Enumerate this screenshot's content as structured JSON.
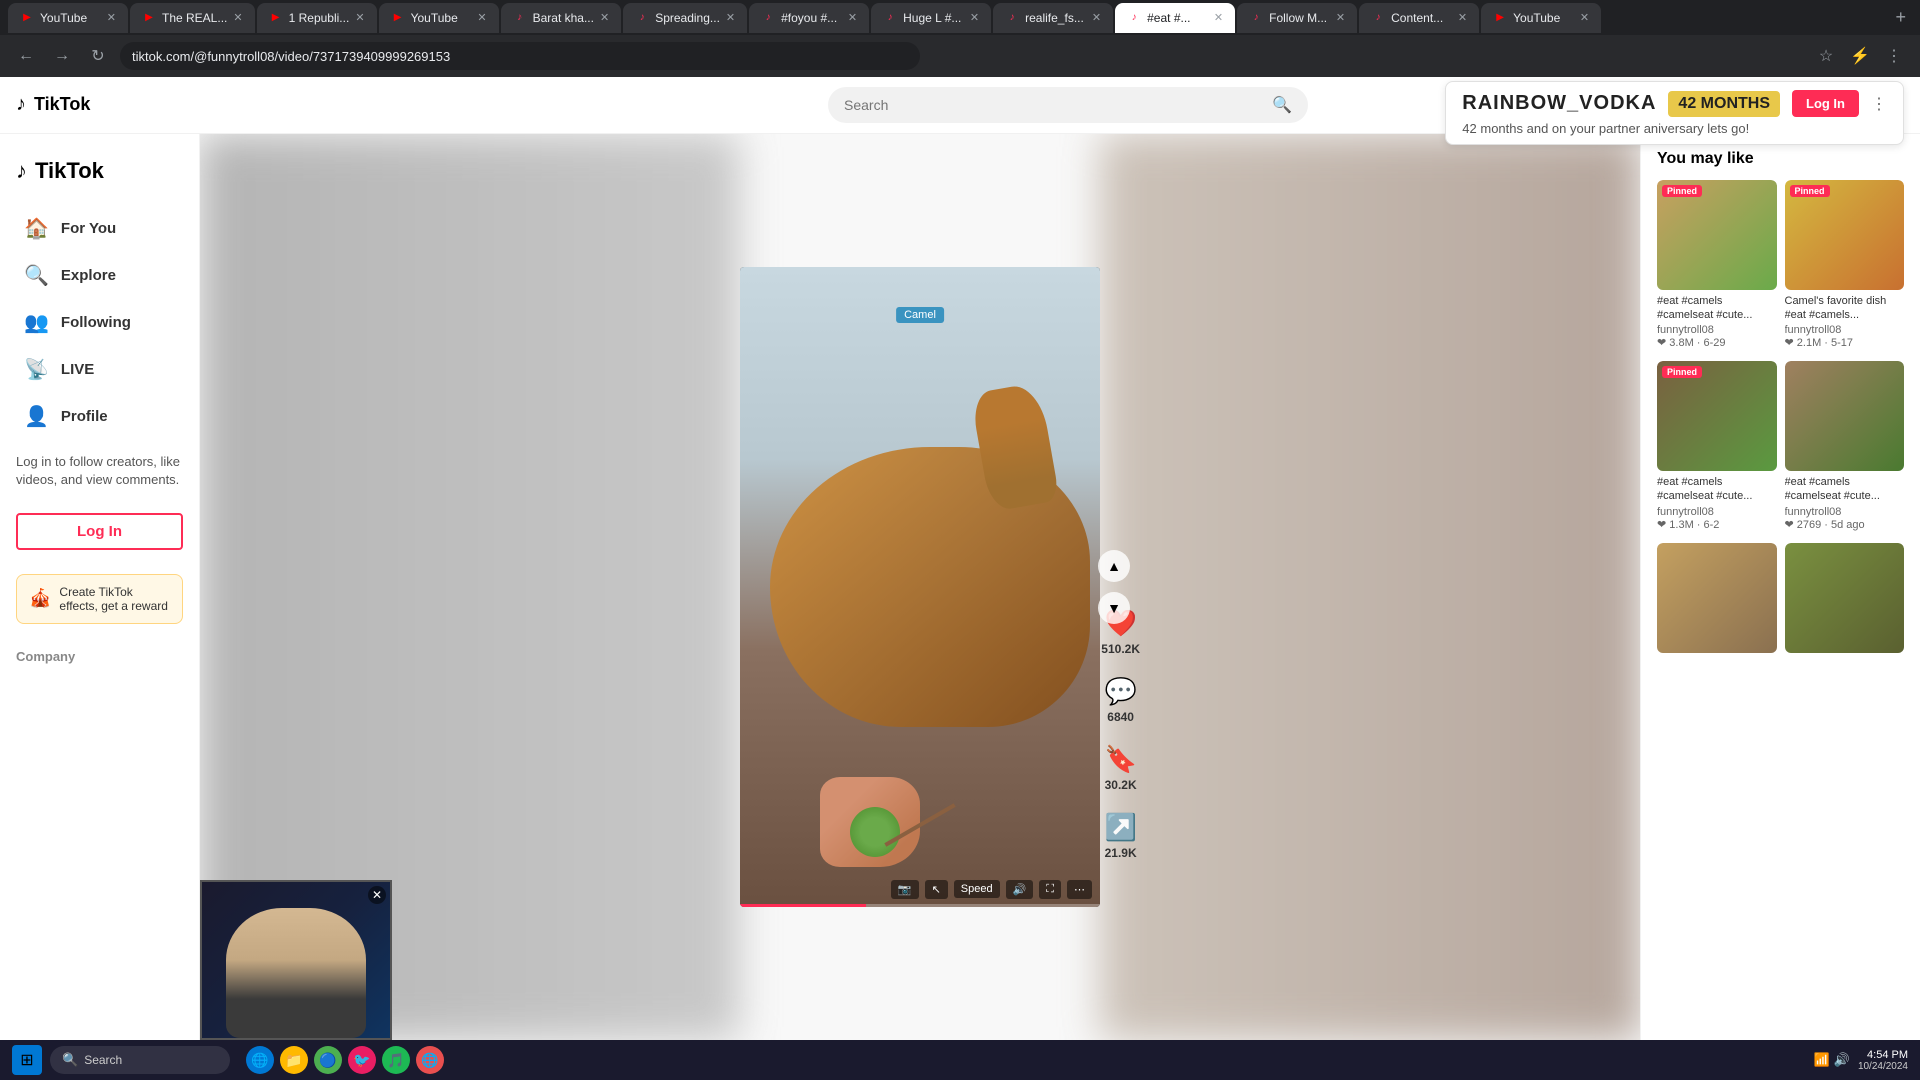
{
  "browser": {
    "tabs": [
      {
        "label": "YouTube",
        "favicon": "▶",
        "active": false,
        "color": "#ff0000"
      },
      {
        "label": "The REAL...",
        "favicon": "▶",
        "active": false,
        "color": "#ff0000"
      },
      {
        "label": "1 Republi...",
        "favicon": "▶",
        "active": false,
        "color": "#ff0000"
      },
      {
        "label": "YouTube",
        "favicon": "▶",
        "active": false,
        "color": "#ff0000"
      },
      {
        "label": "Barat kha...",
        "favicon": "♪",
        "active": false,
        "color": "#fe2c55"
      },
      {
        "label": "Spreading...",
        "favicon": "♪",
        "active": false,
        "color": "#fe2c55"
      },
      {
        "label": "#foyou #...",
        "favicon": "♪",
        "active": false,
        "color": "#fe2c55"
      },
      {
        "label": "Huge L #...",
        "favicon": "♪",
        "active": false,
        "color": "#fe2c55"
      },
      {
        "label": "realife_fs...",
        "favicon": "♪",
        "active": false,
        "color": "#fe2c55"
      },
      {
        "label": "#eat #...",
        "favicon": "♪",
        "active": true,
        "color": "#fe2c55"
      },
      {
        "label": "Follow M...",
        "favicon": "♪",
        "active": false,
        "color": "#fe2c55"
      },
      {
        "label": "Content...",
        "favicon": "♪",
        "active": false,
        "color": "#fe2c55"
      },
      {
        "label": "YouTube",
        "favicon": "▶",
        "active": false,
        "color": "#ff0000"
      }
    ],
    "address": "tiktok.com/@funnytroll08/video/7371739409999269153"
  },
  "header": {
    "logo": "TikTok",
    "search_placeholder": "Search"
  },
  "sidebar": {
    "logo_text": "TikTok",
    "nav_items": [
      {
        "label": "For You",
        "icon": "🏠"
      },
      {
        "label": "Explore",
        "icon": "🔍"
      },
      {
        "label": "Following",
        "icon": "👥"
      },
      {
        "label": "LIVE",
        "icon": "📡"
      },
      {
        "label": "Profile",
        "icon": "👤"
      }
    ],
    "login_prompt": "Log in to follow creators, like videos, and view comments.",
    "login_btn": "Log In",
    "effects_text": "Create TikTok effects, get a reward",
    "company_label": "Company"
  },
  "video": {
    "overlay_text": "Camel",
    "like_count": "510.2K",
    "comment_count": "6840",
    "save_count": "30.2K",
    "share_count": "21.9K",
    "speed_label": "Speed"
  },
  "anniversary": {
    "brand": "RAINBOW_VODKA",
    "months": "42 MONTHS",
    "subtitle": "42 months and on your partner aniversary lets go!",
    "login_btn": "Log In"
  },
  "right_panel": {
    "title": "You may like",
    "videos": [
      {
        "title": "#eat #camels #camelseat #cute...",
        "user": "funnytroll08",
        "likes": "3.8M",
        "date": "6-29",
        "pinned": true,
        "color1": "#8B6543",
        "color2": "#4a7a30"
      },
      {
        "title": "Camel's favorite dish #eat #camels...",
        "user": "funnytroll08",
        "likes": "2.1M",
        "date": "5-17",
        "pinned": true,
        "color1": "#c8a060",
        "color2": "#d4c040"
      },
      {
        "title": "#eat #camels #camelseat #cute...",
        "user": "funnytroll08",
        "likes": "1.3M",
        "date": "6-2",
        "pinned": true,
        "color1": "#7a6040",
        "color2": "#4a8030"
      },
      {
        "title": "#eat #camels #camelseat #cute...",
        "user": "funnytroll08",
        "likes": "2769",
        "date": "5d ago",
        "pinned": false,
        "color1": "#9a8060",
        "color2": "#6a9050"
      },
      {
        "title": "",
        "user": "",
        "likes": "",
        "date": "",
        "pinned": false,
        "color1": "#c4a060",
        "color2": "#8a7050"
      },
      {
        "title": "",
        "user": "",
        "likes": "",
        "date": "",
        "pinned": false,
        "color1": "#7a9040",
        "color2": "#5a7030"
      }
    ]
  },
  "taskbar": {
    "search_text": "Search",
    "time": "4:54 PM",
    "date": "10/24/2024"
  }
}
